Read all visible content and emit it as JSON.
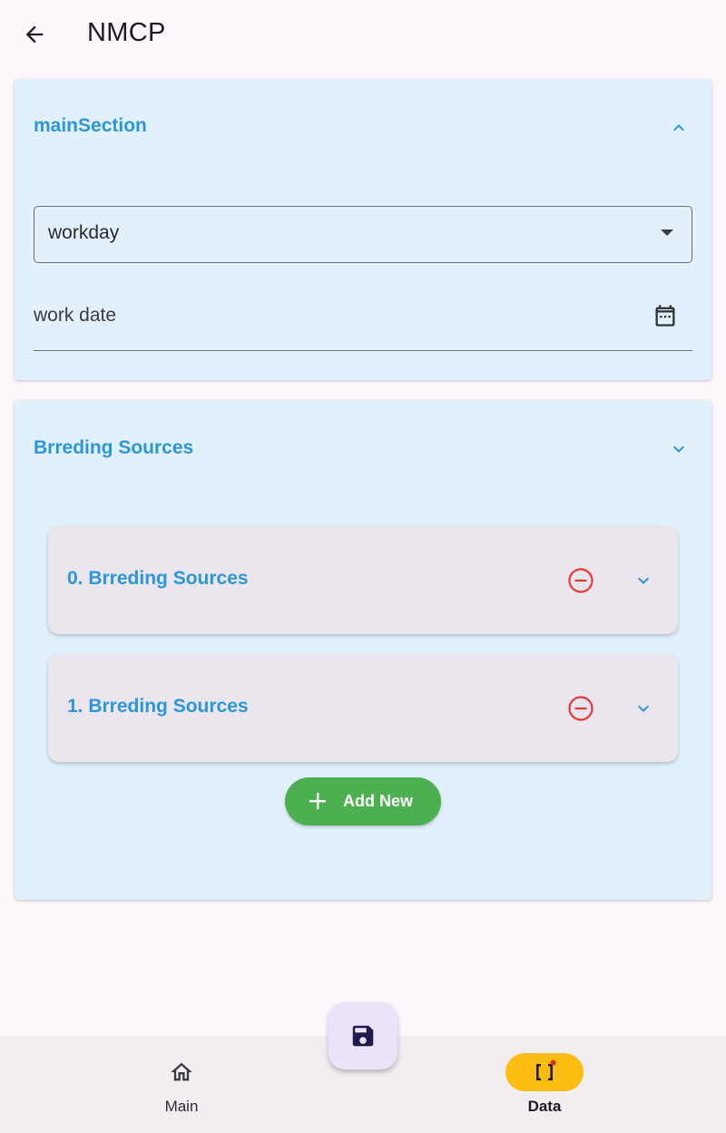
{
  "appbar": {
    "title": "NMCP",
    "back_icon": "arrow-back-icon"
  },
  "main_section": {
    "title": "mainSection",
    "expanded": true,
    "workday_dropdown": {
      "value": "workday"
    },
    "work_date_field": {
      "label": "work date",
      "icon": "calendar-icon"
    }
  },
  "breeding_section": {
    "title": "Brreding Sources",
    "items": [
      {
        "label": "0. Brreding Sources"
      },
      {
        "label": "1. Brreding Sources"
      }
    ],
    "add_button_label": "Add New"
  },
  "fab": {
    "icon": "save-icon"
  },
  "bottom_nav": {
    "items": [
      {
        "label": "Main",
        "icon": "home-icon",
        "selected": false
      },
      {
        "label": "Data",
        "icon": "data-array-icon",
        "selected": true
      }
    ]
  },
  "colors": {
    "accent": "#2b97d9",
    "card_bg": "#e1f0fb",
    "remove": "#e53935",
    "add_button": "#4caf50",
    "selected_nav": "#fbbd12"
  }
}
